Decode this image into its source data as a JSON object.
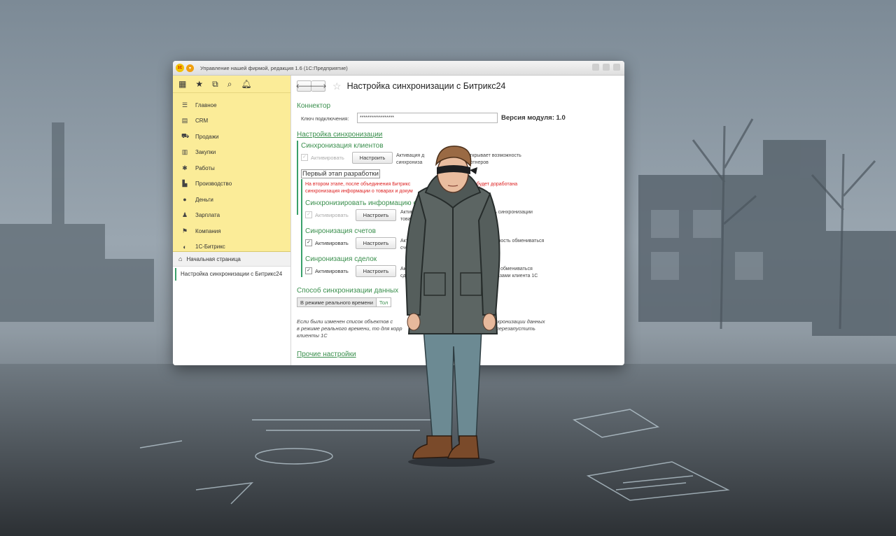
{
  "window": {
    "title": "Управление нашей фирмой, редакция 1.6  (1С:Предприятие)",
    "logo_text": "1С"
  },
  "sidebar": {
    "items": [
      {
        "label": "Главное",
        "icon": "list-icon"
      },
      {
        "label": "CRM",
        "icon": "crm-icon"
      },
      {
        "label": "Продажи",
        "icon": "cart-icon"
      },
      {
        "label": "Закупки",
        "icon": "truck-icon"
      },
      {
        "label": "Работы",
        "icon": "tools-icon"
      },
      {
        "label": "Производство",
        "icon": "factory-icon"
      },
      {
        "label": "Деньги",
        "icon": "money-icon"
      },
      {
        "label": "Зарплата",
        "icon": "people-icon"
      },
      {
        "label": "Компания",
        "icon": "flag-icon"
      },
      {
        "label": "1С-Битрикс",
        "icon": "bitrix-icon"
      }
    ],
    "home_label": "Начальная страница",
    "open_tab": "Настройка синхронизации с Битрикс24"
  },
  "form": {
    "title": "Настройка синхронизации с Битрикс24",
    "connector_heading": "Коннектор",
    "key_label": "Ключ подключения:",
    "key_value": "******************",
    "module_version": "Версия модуля: 1.0",
    "sync_settings_link": "Настройка синхронизации",
    "clients_heading": "Синхронизация клиентов",
    "activate_label": "Активировать",
    "configure_label": "Настроить",
    "clients_desc_1": "Активация д",
    "clients_desc_1b": "жима открывает возможность",
    "clients_desc_2": "синхрониза",
    "clients_desc_2b": "тов и партнеров",
    "first_stage": "Первый этап разработки",
    "warning_1": "На втором этапе, после объединения Битрикс",
    "warning_1b": "магазином, будет доработана",
    "warning_2": "синхронизация информации о товарах и докум",
    "products_heading": "Синхронизировать информацию о тов",
    "products_desc_1": "Активац",
    "products_desc_1b": "т возможность синхронизации",
    "products_desc_2": "товар",
    "invoices_heading": "Синронизация счетов",
    "invoices_desc_1": "Акти",
    "invoices_desc_1b": "зможность обмениваться",
    "invoices_desc_2": "счет",
    "deals_heading": "Синронизация сделок",
    "deals_desc_1": "Акти",
    "deals_desc_1b": "ность обмениваться",
    "deals_desc_2": "сд",
    "deals_desc_2b": "заказами клиента 1С",
    "mode_heading": "Способ синхронизации данных",
    "mode_realtime": "В режиме реального времени",
    "mode_only": "Тол",
    "note_1": "Если были изменен список объектов с",
    "note_1b": "режим синхронизации данных",
    "note_2": "в режиме реального времени, то для корр",
    "note_2b": "тся перезапустить",
    "note_3": "клиенты 1С",
    "other_settings": "Прочие настройки"
  },
  "colors": {
    "sidebar_bg": "#fbec98",
    "accent_green": "#3a8f4d",
    "warning_red": "#d22222"
  }
}
